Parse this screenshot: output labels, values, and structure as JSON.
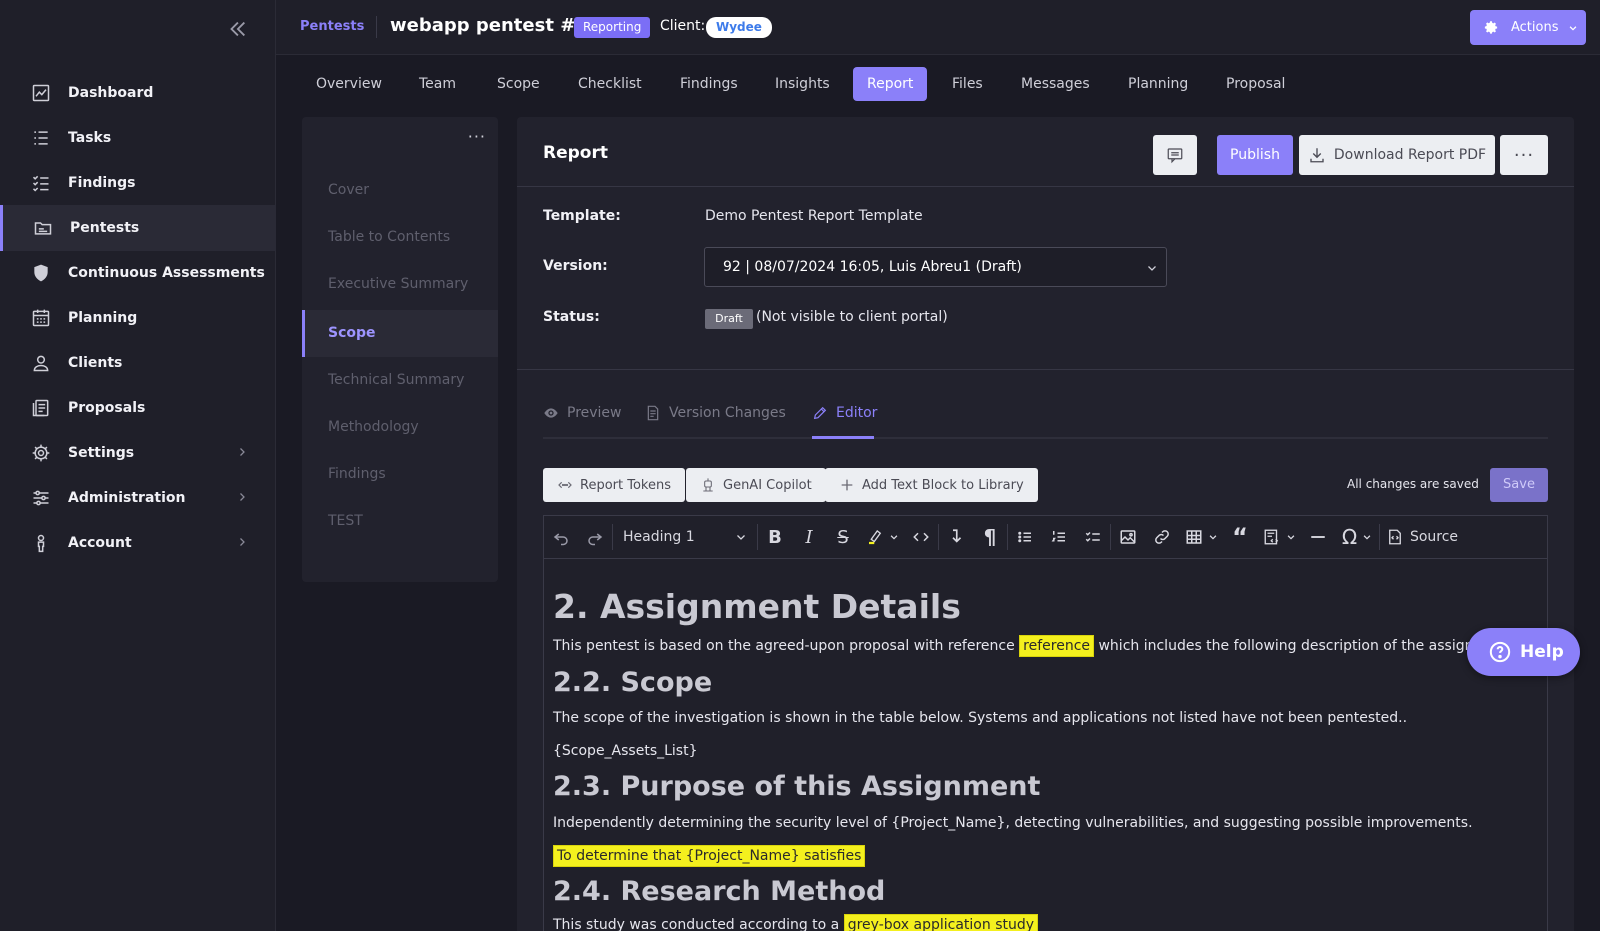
{
  "sidebar": {
    "items": [
      {
        "label": "Dashboard",
        "icon": "dashboard-chart-icon"
      },
      {
        "label": "Tasks",
        "icon": "list-icon"
      },
      {
        "label": "Findings",
        "icon": "checklist-icon"
      },
      {
        "label": "Pentests",
        "icon": "folder-icon"
      },
      {
        "label": "Continuous Assessments",
        "icon": "shield-icon"
      },
      {
        "label": "Planning",
        "icon": "calendar-icon"
      },
      {
        "label": "Clients",
        "icon": "user-icon"
      },
      {
        "label": "Proposals",
        "icon": "document-stack-icon"
      },
      {
        "label": "Settings",
        "icon": "gear-icon"
      },
      {
        "label": "Administration",
        "icon": "sliders-icon"
      },
      {
        "label": "Account",
        "icon": "person-icon"
      }
    ]
  },
  "header": {
    "breadcrumb": "Pentests",
    "title": "webapp pentest #2",
    "status_badge": "Reporting",
    "client_label": "Client:",
    "client_name": "Wydee",
    "actions_label": "Actions"
  },
  "tabs": [
    "Overview",
    "Team",
    "Scope",
    "Checklist",
    "Findings",
    "Insights",
    "Report",
    "Files",
    "Messages",
    "Planning",
    "Proposal"
  ],
  "sections": [
    "Cover",
    "Table to Contents",
    "Executive Summary",
    "Scope",
    "Technical Summary",
    "Methodology",
    "Findings",
    "TEST"
  ],
  "report": {
    "title": "Report",
    "publish_label": "Publish",
    "download_label": "Download Report PDF",
    "template_label": "Template:",
    "template_value": "Demo Pentest Report Template",
    "version_label": "Version:",
    "version_value": "92 | 08/07/2024 16:05, Luis Abreu1 (Draft)",
    "status_label": "Status:",
    "status_badge": "Draft",
    "status_note": "(Not visible to client portal)",
    "subtabs": [
      "Preview",
      "Version Changes",
      "Editor"
    ],
    "report_tokens": "Report Tokens",
    "genai_copilot": "GenAI Copilot",
    "add_text_block": "Add Text Block to Library",
    "saved_status": "All changes are saved",
    "save_label": "Save"
  },
  "toolbar": {
    "heading_select": "Heading 1",
    "source_label": "Source"
  },
  "editor": {
    "h_assignment": "2. Assignment Details",
    "p_assignment_a": "This pentest is based on the agreed-upon proposal with reference ",
    "p_assignment_hl": "reference",
    "p_assignment_b": " which includes the following description of the assignment:",
    "h_scope": "2.2. Scope",
    "p_scope": "The scope of the investigation is shown in the table below. Systems and applications not listed have not been pentested..",
    "p_scope_token": "{Scope_Assets_List}",
    "h_purpose": "2.3. Purpose of this Assignment",
    "p_purpose": "Independently determining the security level of {Project_Name}, detecting vulnerabilities, and suggesting possible improvements.",
    "p_purpose_hl": "To determine that {Project_Name} satisfies",
    "h_method": "2.4. Research Method",
    "p_method_a": "This study was conducted according to a ",
    "p_method_hl": "grey-box application study"
  },
  "help_label": "Help",
  "colors": {
    "accent": "#8b80f9",
    "highlight": "#f4f01e",
    "background": "#1a1a24"
  }
}
